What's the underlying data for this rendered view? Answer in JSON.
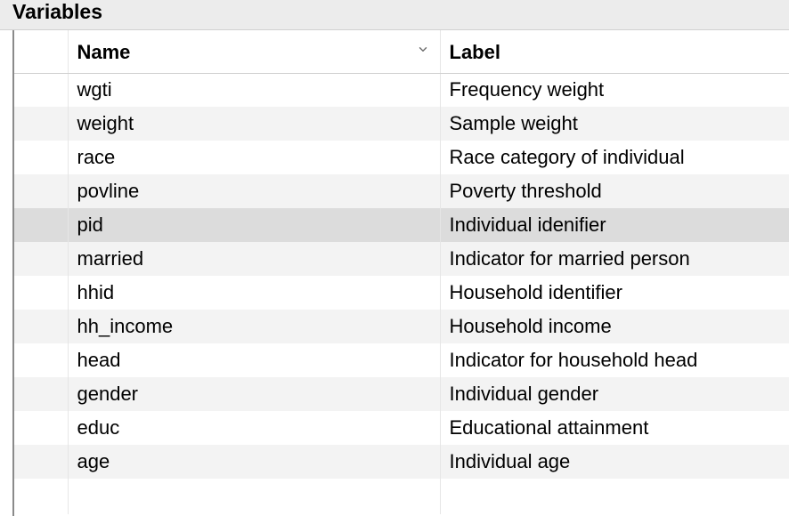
{
  "panel": {
    "title": "Variables"
  },
  "columns": {
    "name": "Name",
    "label": "Label"
  },
  "sort": {
    "direction": "desc"
  },
  "rows": [
    {
      "name": "wgti",
      "label": "Frequency weight",
      "selected": false
    },
    {
      "name": "weight",
      "label": "Sample weight",
      "selected": false
    },
    {
      "name": "race",
      "label": "Race category of individual",
      "selected": false
    },
    {
      "name": "povline",
      "label": "Poverty threshold",
      "selected": false
    },
    {
      "name": "pid",
      "label": "Individual idenifier",
      "selected": true
    },
    {
      "name": "married",
      "label": "Indicator for married person",
      "selected": false
    },
    {
      "name": "hhid",
      "label": "Household identifier",
      "selected": false
    },
    {
      "name": "hh_income",
      "label": "Household income",
      "selected": false
    },
    {
      "name": "head",
      "label": "Indicator for household head",
      "selected": false
    },
    {
      "name": "gender",
      "label": "Individual gender",
      "selected": false
    },
    {
      "name": "educ",
      "label": "Educational attainment",
      "selected": false
    },
    {
      "name": "age",
      "label": "Individual age",
      "selected": false
    }
  ]
}
